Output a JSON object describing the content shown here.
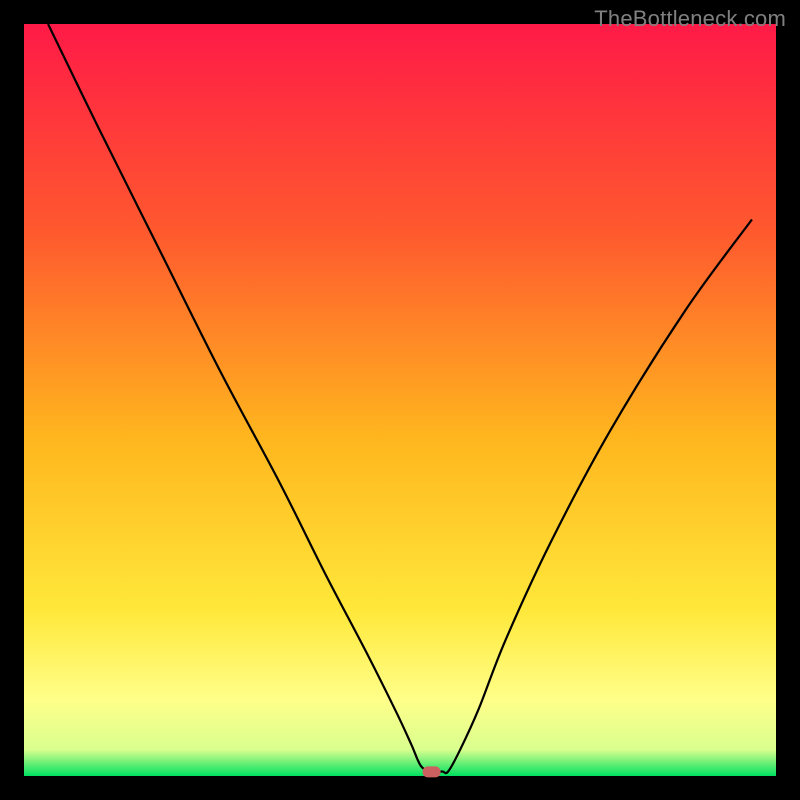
{
  "watermark": "TheBottleneck.com",
  "chart_data": {
    "type": "line",
    "title": "",
    "xlabel": "",
    "ylabel": "",
    "xlim": [
      0,
      100
    ],
    "ylim": [
      0,
      100
    ],
    "grid": false,
    "background": {
      "type": "vertical-gradient",
      "stops": [
        {
          "offset": 0,
          "color": "#ff1a47"
        },
        {
          "offset": 0.28,
          "color": "#ff5a2e"
        },
        {
          "offset": 0.55,
          "color": "#ffb61e"
        },
        {
          "offset": 0.78,
          "color": "#ffe83a"
        },
        {
          "offset": 0.9,
          "color": "#ffff8a"
        },
        {
          "offset": 0.965,
          "color": "#d9ff8e"
        },
        {
          "offset": 1.0,
          "color": "#00e060"
        }
      ]
    },
    "frame": {
      "left": 3,
      "right": 3,
      "top": 3,
      "bottom": 3,
      "color": "#000000"
    },
    "series": [
      {
        "name": "bottleneck-curve",
        "x": [
          3.2,
          10,
          18,
          26,
          34,
          40,
          45.5,
          49.5,
          51.5,
          52.8,
          54.2,
          55.6,
          56.4,
          58,
          60.5,
          64,
          70,
          78,
          88,
          96.8
        ],
        "y": [
          100,
          86,
          70,
          54,
          39,
          27,
          16.5,
          8.5,
          4.2,
          1.3,
          0.6,
          0.6,
          0.6,
          3.5,
          9,
          18,
          31,
          46,
          62,
          74
        ]
      }
    ],
    "marker": {
      "x": 54.2,
      "y": 0.55,
      "color": "#cc6060",
      "shape": "rounded-rect"
    }
  }
}
